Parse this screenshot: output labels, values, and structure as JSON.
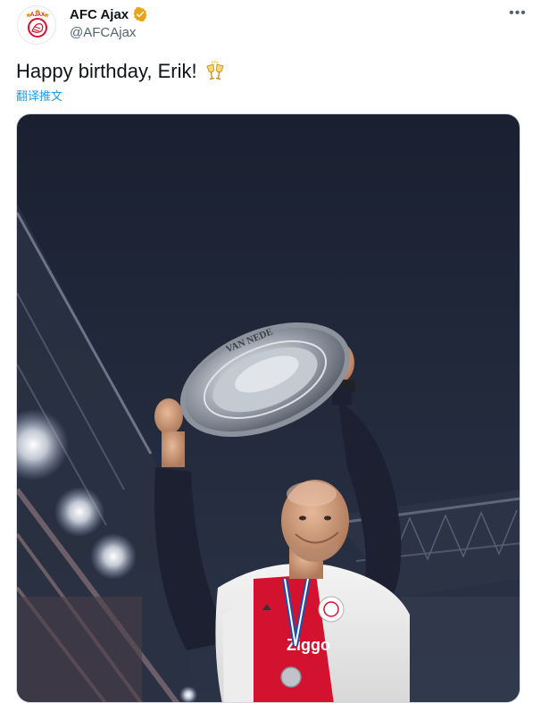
{
  "author": {
    "display_name": "AFC Ajax",
    "handle": "@AFCAjax",
    "avatar_icon": "ajax-logo-icon",
    "verified_icon": "verified-badge-icon",
    "verified_color": "#e8a317"
  },
  "menu": {
    "icon": "more-options-icon",
    "glyph": "•••"
  },
  "tweet": {
    "text": "Happy birthday, Erik!",
    "emoji_icon": "clinking-glasses-icon",
    "translate_label": "翻译推文"
  },
  "media": {
    "description_icon": "trophy-celebration-photo",
    "trophy_inscription": "VAN NEDE"
  },
  "colors": {
    "text": "#0f1419",
    "secondary": "#536471",
    "link": "#1d9bf0",
    "ajax_red": "#d2122e"
  }
}
